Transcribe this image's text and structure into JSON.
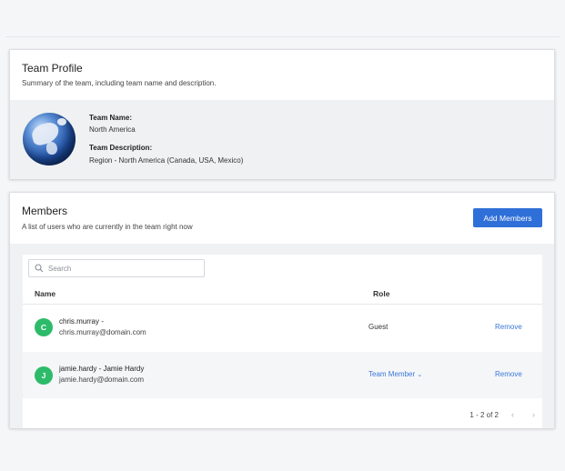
{
  "team_profile": {
    "title": "Team Profile",
    "subtitle": "Summary of the team, including team name and description.",
    "name_label": "Team Name:",
    "name_value": "North America",
    "description_label": "Team Description:",
    "description_value": "Region - North America (Canada, USA, Mexico)"
  },
  "members": {
    "title": "Members",
    "subtitle": "A list of users who are currently in the team right now",
    "add_button": "Add Members",
    "search_placeholder": "Search",
    "columns": {
      "name": "Name",
      "role": "Role"
    },
    "rows": [
      {
        "initial": "C",
        "name": "chris.murray -",
        "email": "chris.murray@domain.com",
        "role": "Guest",
        "action": "Remove"
      },
      {
        "initial": "J",
        "name": "jamie.hardy - Jamie Hardy",
        "email": "jamie.hardy@domain.com",
        "role": "Team Member",
        "action": "Remove"
      }
    ],
    "pagination": "1 - 2 of 2"
  },
  "colors": {
    "accent": "#2f6fd8",
    "avatar": "#2dbb6a",
    "link": "#3a78d8"
  }
}
